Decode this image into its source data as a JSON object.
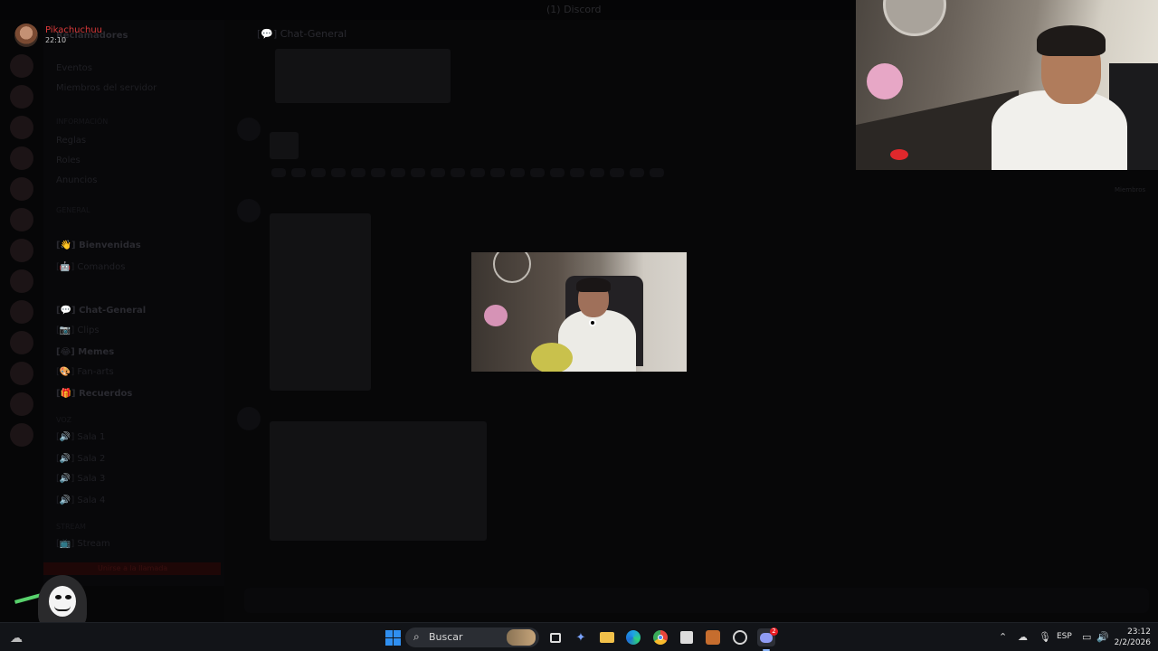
{
  "discord": {
    "window_title": "(1) Discord",
    "streamer": {
      "name": "Pikachuchuu",
      "time": "22:10"
    },
    "server_name": "Reclamadores",
    "channel_header": "[💬] Chat-General",
    "channels": [
      {
        "label": "Eventos",
        "bold": false
      },
      {
        "label": "Miembros del servidor",
        "bold": false
      },
      {
        "label": "INFORMACIÓN",
        "bold": false
      },
      {
        "label": "Reglas",
        "bold": false
      },
      {
        "label": "Roles",
        "bold": false
      },
      {
        "label": "Anuncios",
        "bold": false
      },
      {
        "label": "GENERAL",
        "bold": false
      },
      {
        "label": "[👋] Bienvenidas",
        "bold": true
      },
      {
        "label": "[🤖] Comandos",
        "bold": false
      },
      {
        "label": "[💬] Chat-General",
        "bold": true
      },
      {
        "label": "[📷] Clips",
        "bold": false
      },
      {
        "label": "[😂] Memes",
        "bold": true
      },
      {
        "label": "[🎨] Fan-arts",
        "bold": false
      },
      {
        "label": "[🎁] Recuerdos",
        "bold": true
      },
      {
        "label": "VOZ",
        "bold": false
      },
      {
        "label": "[🔊] Sala 1",
        "bold": false
      },
      {
        "label": "[🔊] Sala 2",
        "bold": false
      },
      {
        "label": "[🔊] Sala 3",
        "bold": false
      },
      {
        "label": "[🔊] Sala 4",
        "bold": false
      },
      {
        "label": "STREAM",
        "bold": false
      },
      {
        "label": "[📺] Stream",
        "bold": false
      }
    ],
    "red_strip_text": "Unirse a la llamada",
    "header_right": "Miembros"
  },
  "taskbar": {
    "search_label": "Buscar",
    "language": "ESP",
    "time": "23:12",
    "date": "2/2/2026",
    "discord_badge": "2",
    "apps": [
      "start-icon",
      "search-icon",
      "task-view-icon",
      "copilot-icon",
      "file-explorer-icon",
      "edge-icon",
      "chrome-icon",
      "store-icon",
      "game-icon",
      "steam-icon",
      "discord-icon"
    ],
    "accent": "#2f8ff0"
  }
}
